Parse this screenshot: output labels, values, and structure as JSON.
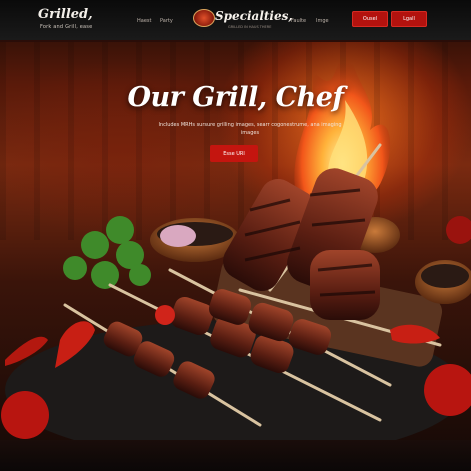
{
  "header": {
    "logo_title": "Grilled,",
    "logo_subtitle": "Fork and Grill, ease",
    "nav_left": [
      "Haest",
      "Party"
    ],
    "brand_title": "Specialties,",
    "brand_subtitle": "GRILLED IN HAUS THERE",
    "nav_right": [
      "Faulte",
      "Imge"
    ],
    "buttons": [
      "Ousel",
      "Lgall"
    ]
  },
  "hero": {
    "title": "Our Grill, Chef",
    "subtitle": "Includes MRHs sursure grilling images, searr cogonestrume, ana imaging images",
    "cta_label": "Esse URl"
  },
  "colors": {
    "accent_red": "#c4150f",
    "flame_orange": "#ff7a1e",
    "header_bg": "#0a0a0a"
  },
  "icons": [
    "brand-emblem-icon"
  ]
}
